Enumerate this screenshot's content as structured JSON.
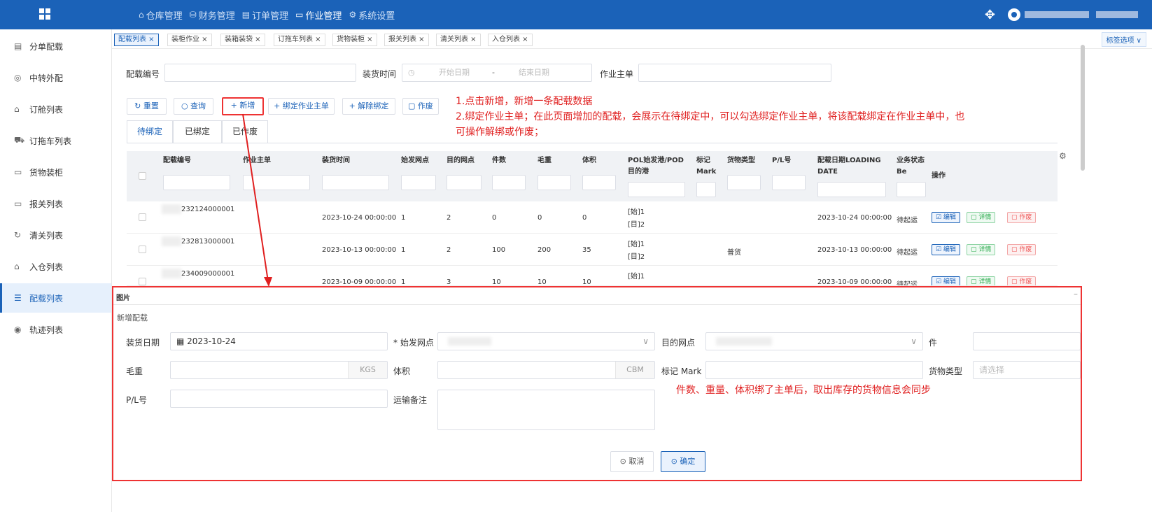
{
  "topbar": {
    "nav": [
      {
        "icon": "⌂",
        "label": "仓库管理"
      },
      {
        "icon": "⛁",
        "label": "财务管理"
      },
      {
        "icon": "▤",
        "label": "订单管理"
      },
      {
        "icon": "▭",
        "label": "作业管理",
        "active": true
      },
      {
        "icon": "⚙",
        "label": "系统设置"
      }
    ]
  },
  "sidebar": {
    "items": [
      {
        "icon": "▤",
        "label": "分单配载"
      },
      {
        "icon": "◎",
        "label": "中转外配"
      },
      {
        "icon": "⌂",
        "label": "订舱列表"
      },
      {
        "icon": "⛟",
        "label": "订拖车列表"
      },
      {
        "icon": "▭",
        "label": "货物装柜"
      },
      {
        "icon": "▭",
        "label": "报关列表"
      },
      {
        "icon": "↻",
        "label": "清关列表"
      },
      {
        "icon": "⌂",
        "label": "入仓列表"
      },
      {
        "icon": "☰",
        "label": "配载列表",
        "active": true
      },
      {
        "icon": "◉",
        "label": "轨迹列表"
      }
    ]
  },
  "tabs": [
    "配载列表 ×",
    "装柜作业 ×",
    "装箱装袋 ×",
    "订拖车列表 ×",
    "货物装柜 ×",
    "报关列表 ×",
    "清关列表 ×",
    "入仓列表 ×"
  ],
  "tag_options": "标签选项 ∨",
  "filters": {
    "peizai_no_label": "配载编号",
    "load_time_label": "装货时间",
    "start_placeholder": "开始日期",
    "dash": "-",
    "end_placeholder": "结束日期",
    "master_label": "作业主单"
  },
  "toolbar": {
    "reset": "↻ 重置",
    "query": "○ 查询",
    "add": "+ 新增",
    "bind": "+ 绑定作业主单",
    "unbind": "+ 解除绑定",
    "void": "▢ 作废"
  },
  "notes": {
    "line1": "1.点击新增，新增一条配载数据",
    "line2": "2.绑定作业主单；在此页面增加的配载，会展示在待绑定中，可以勾选绑定作业主单，将该配载绑定在作业主单中，也",
    "line3": "可操作解绑或作废；",
    "dialog_note": "件数、重量、体积绑了主单后，取出库存的货物信息会同步"
  },
  "subtabs": [
    "待绑定",
    "已绑定",
    "已作废"
  ],
  "table": {
    "headers": [
      "配载编号",
      "作业主单",
      "装货时间",
      "始发网点",
      "目的网点",
      "件数",
      "毛重",
      "体积",
      "POL始发港/POD目的港",
      "标记Mark",
      "货物类型",
      "P/L号",
      "配载日期LOADING DATE",
      "业务状态Be",
      "操作"
    ],
    "rows": [
      {
        "no": "232124000001",
        "time": "2023-10-24 00:00:00",
        "origin": "1",
        "dest": "2",
        "pcs": "0",
        "gw": "0",
        "vol": "0",
        "pol": "[始]1",
        "pod": "[目]2",
        "cargo": "",
        "date": "2023-10-24 00:00:00",
        "status": "待起运"
      },
      {
        "no": "232813000001",
        "time": "2023-10-13 00:00:00",
        "origin": "1",
        "dest": "2",
        "pcs": "100",
        "gw": "200",
        "vol": "35",
        "pol": "[始]1",
        "pod": "[目]2",
        "cargo": "普货",
        "date": "2023-10-13 00:00:00",
        "status": "待起运"
      },
      {
        "no": "234009000001",
        "time": "2023-10-09 00:00:00",
        "origin": "1",
        "dest": "3",
        "pcs": "10",
        "gw": "10",
        "vol": "10",
        "pol": "[始]1",
        "pod": "",
        "cargo": "",
        "date": "2023-10-09 00:00:00",
        "status": "待起运"
      }
    ],
    "actions": {
      "edit": "☑ 编辑",
      "detail": "▢ 详情",
      "void": "▢ 作废"
    }
  },
  "dialog": {
    "header": "图片",
    "title": "新增配载",
    "load_date_label": "装货日期",
    "load_date_value": "▦ 2023-10-24",
    "origin_label": "* 始发网点",
    "dest_label": "目的网点",
    "pcs_label": "件",
    "gw_label": "毛重",
    "gw_unit": "KGS",
    "vol_label": "体积",
    "vol_unit": "CBM",
    "mark_label": "标记 Mark",
    "cargo_label": "货物类型",
    "cargo_placeholder": "请选择",
    "pl_label": "P/L号",
    "remark_label": "运输备注",
    "cancel": "⊙ 取消",
    "confirm": "⊙ 确定"
  },
  "colors": {
    "primary": "#1b62b8",
    "annotation": "#e02020"
  }
}
